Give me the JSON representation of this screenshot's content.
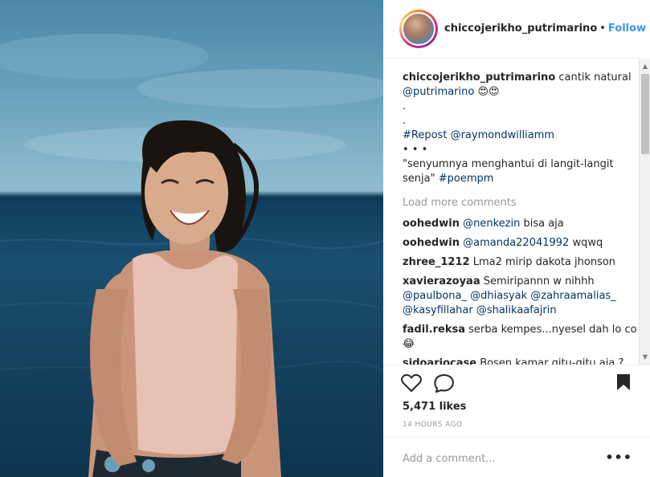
{
  "post": {
    "username": "chiccojerikho_putrimarino",
    "separator": "•",
    "follow_label": "Follow"
  },
  "caption": {
    "username": "chiccojerikho_putrimarino",
    "text": "cantik natural",
    "mention": "@putrimarino",
    "emoji": "😍😍",
    "dot1": ".",
    "dot2": ".",
    "repost_tag": "#Repost",
    "repost_mention": "@raymondwilliamm",
    "ellipsis": "• • •",
    "quote": "\"senyumnya menghantui di langit-langit senja\"",
    "hashtag": "#poempm"
  },
  "load_more": "Load more comments",
  "comments": [
    {
      "user": "oohedwin",
      "mention": "@nenkezin",
      "text": "bisa aja"
    },
    {
      "user": "oohedwin",
      "mention": "@amanda22041992",
      "text": "wqwq"
    },
    {
      "user": "zhree_1212",
      "mention": "",
      "text": "Lma2 mirip dakota jhonson"
    },
    {
      "user": "xavierazoyaa",
      "mention": "",
      "text": "Semiripannn w nihhh"
    },
    {
      "user": "fadil.reksa",
      "mention": "",
      "text": "serba kempes...nyesel dah lo co 😂"
    },
    {
      "user": "sidoariocase",
      "mention": "",
      "text": "Bosen kamar gitu-gitu aja ?"
    }
  ],
  "xavier_mentions": {
    "m1": "@paulbona_",
    "m2": "@dhiasyak",
    "m3": "@zahraamalias_",
    "m4": "@kasyfillahar",
    "m5": "@shalikaafajrin"
  },
  "actions": {
    "like_icon": "heart-icon",
    "comment_icon": "comment-icon",
    "save_icon": "bookmark-icon",
    "likes_text": "5,471 likes",
    "timestamp": "14 HOURS AGO"
  },
  "add_comment": {
    "placeholder": "Add a comment...",
    "more_label": "•••"
  },
  "colors": {
    "link": "#003569",
    "follow": "#3897f0",
    "muted": "#999999"
  }
}
